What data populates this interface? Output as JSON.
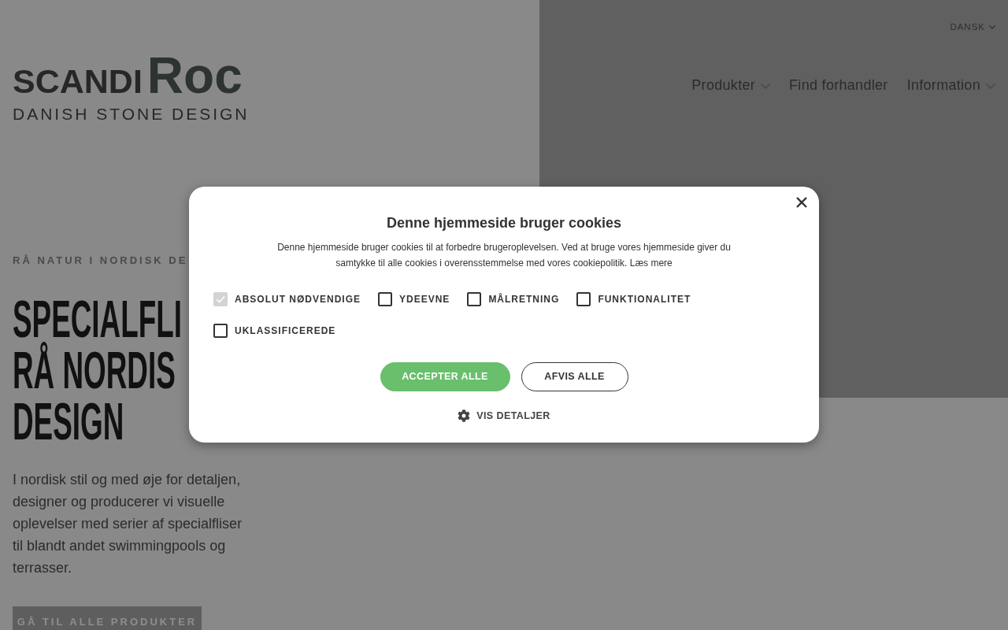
{
  "language_selector": {
    "label": "DANSK"
  },
  "logo": {
    "wordmark_regular": "SCANDI",
    "wordmark_bold": "Roc",
    "tagline": "DANISH STONE DESIGN"
  },
  "nav": [
    {
      "label": "Produkter",
      "has_dropdown": true
    },
    {
      "label": "Find forhandler",
      "has_dropdown": false
    },
    {
      "label": "Information",
      "has_dropdown": true
    }
  ],
  "hero": {
    "eyebrow": "RÅ NATUR I NORDISK DE",
    "headline_lines": [
      "SPECIALFLI",
      "RÅ NORDIS",
      "DESIGN"
    ],
    "body": "I nordisk stil og med øje for detaljen, designer og producerer vi visuelle oplevelser med serier af specialfliser til blandt andet swimmingpools og terrasser.",
    "button": "GÅ TIL ALLE PRODUKTER"
  },
  "cookie_dialog": {
    "title": "Denne hjemmeside bruger cookies",
    "text": "Denne hjemmeside bruger cookies til at forbedre brugeroplevelsen. Ved at bruge vores hjemmeside giver du samtykke til alle cookies i overensstemmelse med vores cookiepolitik.",
    "link": "Læs mere",
    "categories": [
      {
        "label": "ABSOLUT NØDVENDIGE",
        "checked": true,
        "disabled": true
      },
      {
        "label": "YDEEVNE",
        "checked": false,
        "disabled": false
      },
      {
        "label": "MÅLRETNING",
        "checked": false,
        "disabled": false
      },
      {
        "label": "FUNKTIONALITET",
        "checked": false,
        "disabled": false
      },
      {
        "label": "UKLASSIFICEREDE",
        "checked": false,
        "disabled": false
      }
    ],
    "buttons": [
      {
        "label": "ACCEPTER ALLE",
        "kind": "primary"
      },
      {
        "label": "AFVIS ALLE",
        "kind": "secondary"
      }
    ],
    "details_link": "VIS DETALJER"
  }
}
